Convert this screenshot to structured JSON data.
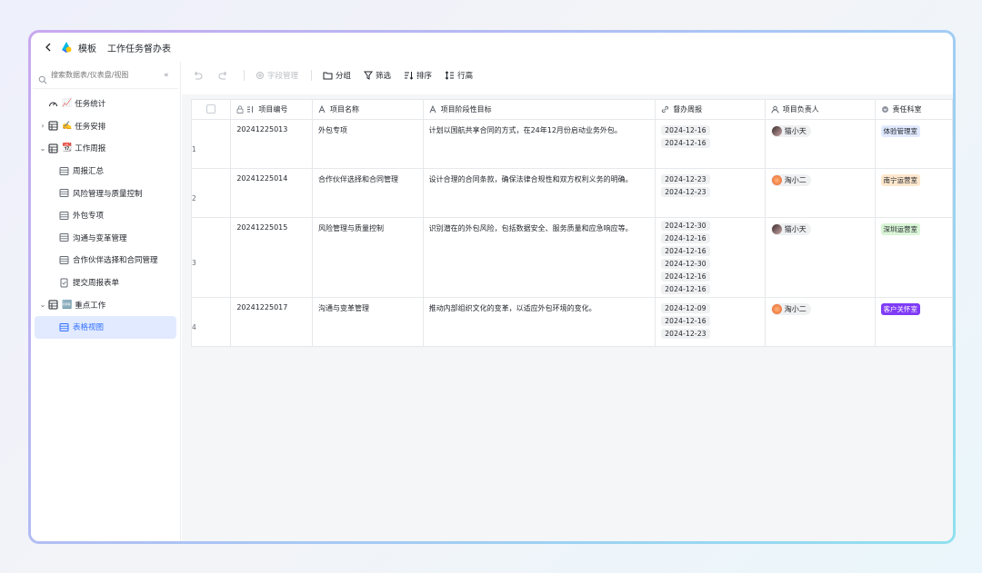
{
  "titlebar": {
    "crumb1": "模板",
    "crumb2": "工作任务督办表"
  },
  "sidebar": {
    "search_placeholder": "搜索数据表/仪表盘/视图",
    "items": [
      {
        "label": "任务统计",
        "emoji": "📈"
      },
      {
        "label": "任务安排",
        "emoji": "✍️"
      },
      {
        "label": "工作周报",
        "emoji": "📆"
      },
      {
        "label": "周报汇总"
      },
      {
        "label": "风险管理与质量控制"
      },
      {
        "label": "外包专项"
      },
      {
        "label": "沟通与变革管理"
      },
      {
        "label": "合作伙伴选择和合同管理"
      },
      {
        "label": "提交周报表单"
      },
      {
        "label": "重点工作",
        "emoji": "🆒"
      },
      {
        "label": "表格视图"
      }
    ]
  },
  "toolbar": {
    "field_manage": "字段管理",
    "group": "分组",
    "filter": "筛选",
    "sort": "排序",
    "row_height": "行高"
  },
  "table": {
    "columns": [
      "项目编号",
      "项目名称",
      "项目阶段性目标",
      "督办周报",
      "项目负责人",
      "责任科室"
    ],
    "rows": [
      {
        "num": "1",
        "code": "20241225013",
        "name": "外包专项",
        "goal": "计划以国航共享合同的方式，在24年12月份启动业务外包。",
        "dates": [
          "2024-12-16",
          "2024-12-16"
        ],
        "owner": "猫小天",
        "dept": "体验管理室"
      },
      {
        "num": "2",
        "code": "20241225014",
        "name": "合作伙伴选择和合同管理",
        "goal": "设计合理的合同条款，确保法律合规性和双方权利义务的明确。",
        "dates": [
          "2024-12-23",
          "2024-12-23"
        ],
        "owner": "淘小二",
        "dept": "南宁运营室"
      },
      {
        "num": "3",
        "code": "20241225015",
        "name": "风险管理与质量控制",
        "goal": "识别潜在的外包风险，包括数据安全、服务质量和应急响应等。",
        "dates": [
          "2024-12-30",
          "2024-12-16",
          "2024-12-16",
          "2024-12-30",
          "2024-12-16",
          "2024-12-16"
        ],
        "owner": "猫小天",
        "dept": "深圳运营室"
      },
      {
        "num": "4",
        "code": "20241225017",
        "name": "沟通与变革管理",
        "goal": "推动内部组织文化的变革，以适应外包环境的变化。",
        "dates": [
          "2024-12-09",
          "2024-12-16",
          "2024-12-23"
        ],
        "owner": "淘小二",
        "dept": "客户关怀室"
      }
    ]
  },
  "colors": {
    "accent": "#3370ff",
    "active_bg": "#e1eaff",
    "tag_tiyan": "#e1eaff",
    "tag_nanning": "#fee7cd",
    "tag_shenzhen": "#d9f5d6",
    "tag_kehu": "#7f3bf5"
  }
}
